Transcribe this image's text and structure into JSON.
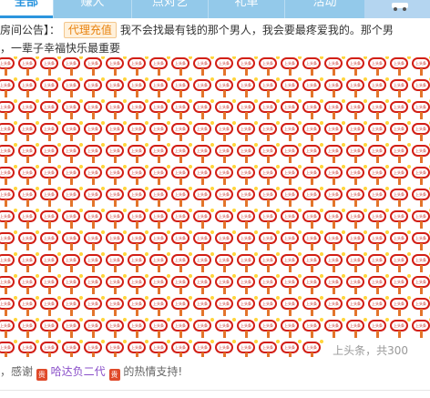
{
  "tabs": [
    {
      "label": "全部",
      "active": true
    },
    {
      "label": "赚人",
      "active": false
    },
    {
      "label": "点对艺",
      "active": false
    },
    {
      "label": "礼单",
      "active": false
    },
    {
      "label": "活动",
      "active": false
    }
  ],
  "notice": {
    "prefix": "房间公告】：",
    "tag": "代理充值",
    "text_line1": "我不会找最有钱的那个男人，我会要最疼爱我的。那个男",
    "text_line2": "，一辈子幸福快乐最重要"
  },
  "gift": {
    "sticker_text": "上头条",
    "counter": "上头条，共300"
  },
  "thanks": {
    "prefix": "，感谢",
    "badge": "贵",
    "user": "哈达负二代",
    "suffix": "的热情支持!"
  },
  "colors": {
    "tabbar": "#93c9ea",
    "tab_active": "#2b95de",
    "sticker_red": "#d21f16",
    "tag_orange": "#e8820e",
    "user_purple": "#8a4fc9"
  }
}
